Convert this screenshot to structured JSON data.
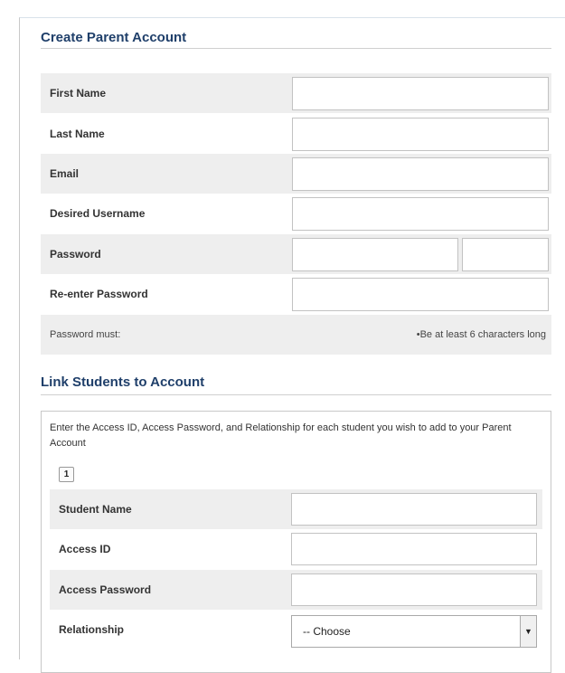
{
  "create": {
    "title": "Create Parent Account",
    "fields": {
      "first_name": "First Name",
      "last_name": "Last Name",
      "email": "Email",
      "username": "Desired Username",
      "password": "Password",
      "reenter_password": "Re-enter Password"
    },
    "password_rule_label": "Password must:",
    "password_rule": "•Be at least 6 characters long"
  },
  "link": {
    "title": "Link Students to Account",
    "instructions": "Enter the Access ID, Access Password, and Relationship for each student you wish to add to your Parent Account",
    "student_tab": "1",
    "fields": {
      "student_name": "Student Name",
      "access_id": "Access ID",
      "access_password": "Access Password",
      "relationship": "Relationship"
    },
    "relationship_selected": "-- Choose"
  }
}
